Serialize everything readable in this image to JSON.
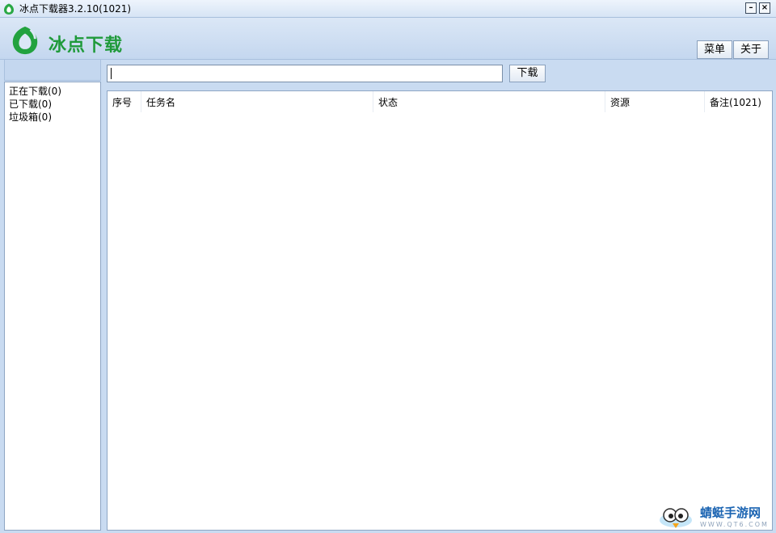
{
  "window": {
    "title": "冰点下载器3.2.10(1021)",
    "minimize_label": "–",
    "close_label": "×"
  },
  "header": {
    "logo_text": "冰点下载",
    "menu_button": "菜单",
    "about_button": "关于"
  },
  "toolbar": {
    "url_value": "",
    "download_button": "下载"
  },
  "sidebar": {
    "items": [
      {
        "label": "正在下载(0)"
      },
      {
        "label": "已下载(0)"
      },
      {
        "label": "垃圾箱(0)"
      }
    ]
  },
  "task_table": {
    "columns": [
      {
        "label": "序号"
      },
      {
        "label": "任务名"
      },
      {
        "label": "状态"
      },
      {
        "label": "资源"
      },
      {
        "label": "备注(1021)"
      }
    ],
    "rows": []
  },
  "watermark": {
    "text": "蜻蜓手游网",
    "sub": "WWW.QT6.COM"
  },
  "colors": {
    "brand_green": "#1f9a3a",
    "chrome_blue": "#c9dbf1",
    "watermark_blue": "#1b64b2"
  }
}
